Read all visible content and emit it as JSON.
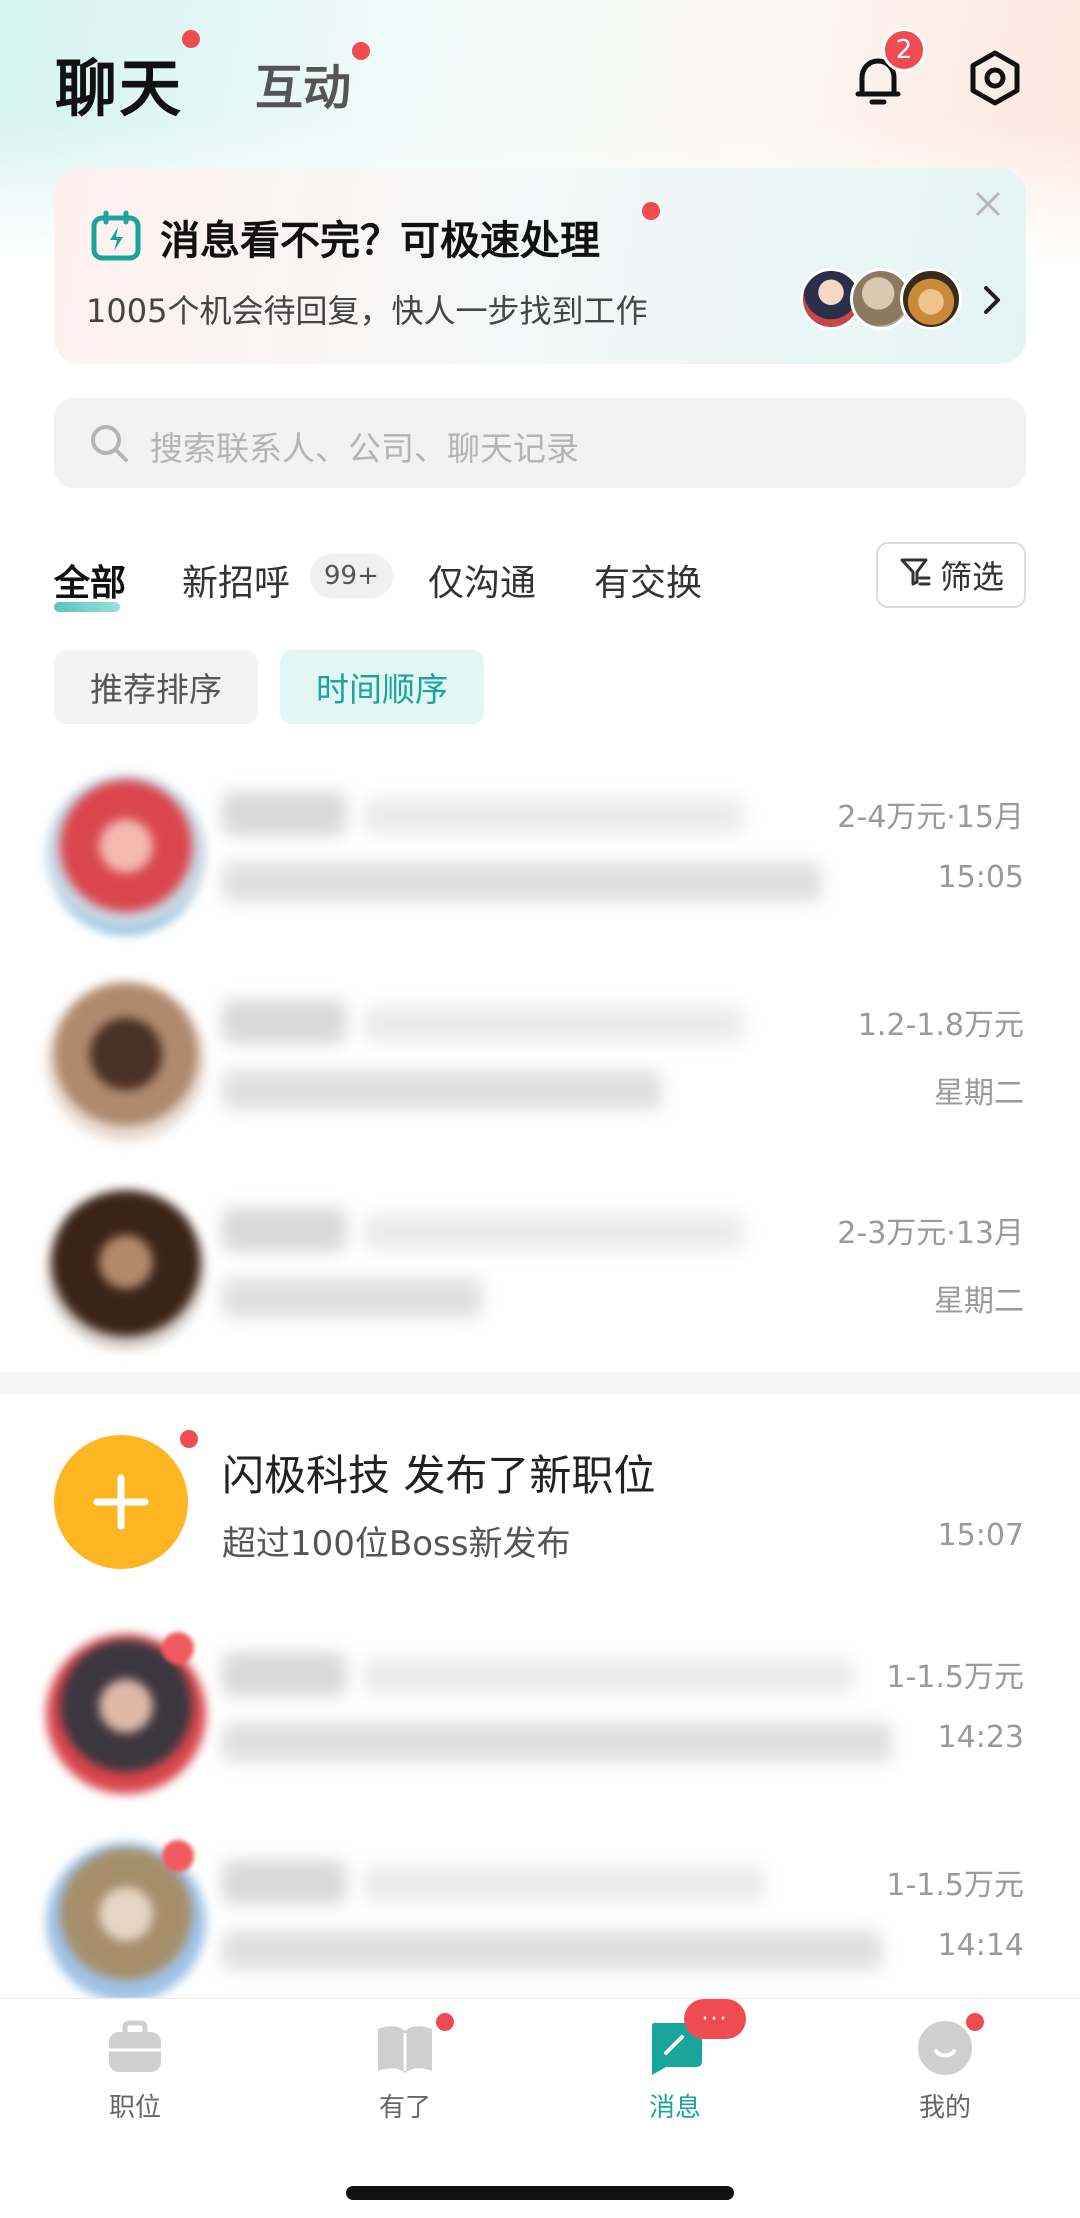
{
  "header": {
    "tab_chat": "聊天",
    "tab_interact": "互动",
    "notification_count": "2"
  },
  "banner": {
    "title": "消息看不完？可极速处理",
    "subtitle": "1005个机会待回复，快人一步找到工作"
  },
  "search": {
    "placeholder": "搜索联系人、公司、聊天记录"
  },
  "tabs": [
    {
      "label": "全部"
    },
    {
      "label": "新招呼"
    },
    {
      "label": "仅沟通"
    },
    {
      "label": "有交换"
    }
  ],
  "tab_new_count": "99+",
  "filter_label": "筛选",
  "sort": {
    "recommended": "推荐排序",
    "by_time": "时间顺序"
  },
  "chats": [
    {
      "salary": "2-4万元·15月",
      "time": "15:05"
    },
    {
      "salary": "1.2-1.8万元",
      "time": "星期二"
    },
    {
      "salary": "2-3万元·13月",
      "time": "星期二"
    },
    {
      "salary": "1-1.5万元",
      "time": "14:23"
    },
    {
      "salary": "1-1.5万元",
      "time": "14:14"
    }
  ],
  "system_notice": {
    "title": "闪极科技 发布了新职位",
    "subtitle": "超过100位Boss新发布",
    "time": "15:07"
  },
  "bottom_nav": [
    {
      "label": "职位"
    },
    {
      "label": "有了"
    },
    {
      "label": "消息"
    },
    {
      "label": "我的"
    }
  ],
  "message_badge": "···",
  "colors": {
    "accent": "#1aa59b",
    "badge_red": "#f14b52",
    "system_avatar": "#ffb623"
  }
}
